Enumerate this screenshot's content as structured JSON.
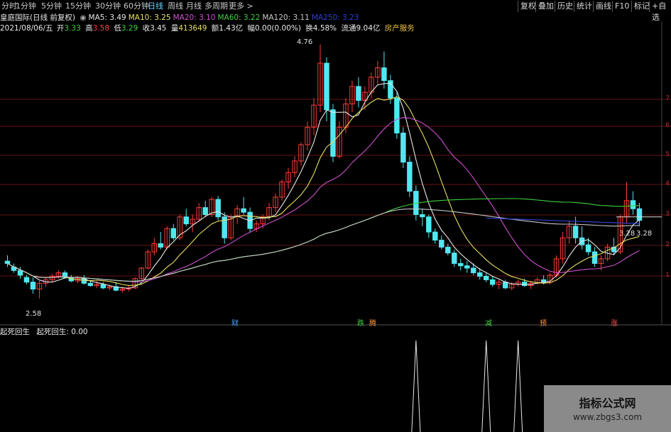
{
  "toolbar": {
    "periods": [
      "分时",
      "1分钟",
      "5分钟",
      "15分钟",
      "30分钟",
      "60分钟",
      "日线",
      "周线",
      "月线",
      "多周期",
      "更多 >"
    ],
    "active_period": "日线",
    "right_buttons": [
      "复权",
      "叠加",
      "历史",
      "统计",
      "画线",
      "F10",
      "标记",
      "+自选"
    ]
  },
  "header": {
    "title": "皇庭国际(日线 前复权)",
    "ma": [
      {
        "label": "MA5: 3.49",
        "color": "#e8e8e8"
      },
      {
        "label": "MA10: 3.25",
        "color": "#e8e060"
      },
      {
        "label": "MA20: 3.10",
        "color": "#d050d0"
      },
      {
        "label": "MA60: 3.22",
        "color": "#40d040"
      },
      {
        "label": "MA120: 3.11",
        "color": "#c8c8c8"
      },
      {
        "label": "MA250: 3.23",
        "color": "#3040d0"
      }
    ],
    "date": "2021/08/06/五",
    "open_label": "开",
    "open": "3.33",
    "high_label": "高",
    "high": "3.58",
    "low_label": "低",
    "low": "3.29",
    "close_label": "收",
    "close": "3.45",
    "vol_label": "量",
    "vol": "413649",
    "amount_label": "额",
    "amount": "1.43亿",
    "change_label": "幅",
    "change": "0.00(0.00%)",
    "turnover_label": "换",
    "turnover": "4.58%",
    "float_label": "流通",
    "float": "9.04亿",
    "sector": "房产服务"
  },
  "price_labels": {
    "high": "4.76",
    "low": "2.58",
    "last": "3.28",
    "last_left": "3.28"
  },
  "y_ticks": [
    "1",
    "2",
    "3",
    "4",
    "5",
    "6",
    "7"
  ],
  "events": [
    {
      "label": "财",
      "color": "#4aa0ff"
    },
    {
      "label": "跌",
      "color": "#40d040"
    },
    {
      "label": "腾",
      "color": "#ff9030"
    },
    {
      "label": "减",
      "color": "#40d040"
    },
    {
      "label": "预",
      "color": "#ff9030"
    },
    {
      "label": "涨",
      "color": "#ff5050"
    }
  ],
  "indicator": {
    "name": "起死回生",
    "value": "起死回生: 0.00"
  },
  "watermark": {
    "title": "指标公式网",
    "url": "www.zbgs3.com"
  },
  "colors": {
    "up": "#ff3a3a",
    "down": "#50e8f0",
    "ma5": "#e8e8e8",
    "ma10": "#e8e060",
    "ma20": "#d050d0",
    "ma60": "#40d040",
    "ma120": "#c8c8c8",
    "ma250": "#3040d0",
    "grid": "#8b1a1a"
  },
  "chart_data": {
    "type": "candlestick",
    "ylim": [
      2.45,
      4.85
    ],
    "candles": [
      [
        2.9,
        2.95,
        2.85,
        2.88
      ],
      [
        2.85,
        2.88,
        2.8,
        2.82
      ],
      [
        2.82,
        2.85,
        2.75,
        2.78
      ],
      [
        2.76,
        2.78,
        2.7,
        2.72
      ],
      [
        2.72,
        2.76,
        2.62,
        2.66
      ],
      [
        2.66,
        2.73,
        2.58,
        2.71
      ],
      [
        2.71,
        2.76,
        2.68,
        2.74
      ],
      [
        2.74,
        2.79,
        2.72,
        2.77
      ],
      [
        2.77,
        2.82,
        2.75,
        2.8
      ],
      [
        2.8,
        2.82,
        2.75,
        2.76
      ],
      [
        2.76,
        2.78,
        2.72,
        2.73
      ],
      [
        2.73,
        2.77,
        2.71,
        2.75
      ],
      [
        2.75,
        2.78,
        2.7,
        2.71
      ],
      [
        2.71,
        2.74,
        2.68,
        2.69
      ],
      [
        2.69,
        2.73,
        2.67,
        2.7
      ],
      [
        2.7,
        2.72,
        2.66,
        2.67
      ],
      [
        2.67,
        2.7,
        2.65,
        2.68
      ],
      [
        2.68,
        2.72,
        2.64,
        2.65
      ],
      [
        2.65,
        2.68,
        2.63,
        2.66
      ],
      [
        2.66,
        2.69,
        2.64,
        2.67
      ],
      [
        2.67,
        2.76,
        2.66,
        2.75
      ],
      [
        2.75,
        2.85,
        2.74,
        2.84
      ],
      [
        2.84,
        3.0,
        2.83,
        2.98
      ],
      [
        2.98,
        3.1,
        2.95,
        3.05
      ],
      [
        3.05,
        3.15,
        3.0,
        3.02
      ],
      [
        3.02,
        3.2,
        3.0,
        3.18
      ],
      [
        3.18,
        3.22,
        3.08,
        3.1
      ],
      [
        3.1,
        3.3,
        3.08,
        3.28
      ],
      [
        3.28,
        3.35,
        3.2,
        3.22
      ],
      [
        3.22,
        3.3,
        3.15,
        3.26
      ],
      [
        3.26,
        3.4,
        3.24,
        3.36
      ],
      [
        3.36,
        3.42,
        3.28,
        3.3
      ],
      [
        3.3,
        3.45,
        3.28,
        3.43
      ],
      [
        3.43,
        3.46,
        3.25,
        3.28
      ],
      [
        3.28,
        3.32,
        3.05,
        3.1
      ],
      [
        3.1,
        3.3,
        3.08,
        3.28
      ],
      [
        3.28,
        3.38,
        3.22,
        3.35
      ],
      [
        3.35,
        3.45,
        3.3,
        3.32
      ],
      [
        3.32,
        3.36,
        3.15,
        3.18
      ],
      [
        3.18,
        3.25,
        3.15,
        3.22
      ],
      [
        3.22,
        3.3,
        3.18,
        3.28
      ],
      [
        3.28,
        3.4,
        3.25,
        3.36
      ],
      [
        3.36,
        3.48,
        3.32,
        3.45
      ],
      [
        3.45,
        3.6,
        3.42,
        3.58
      ],
      [
        3.58,
        3.7,
        3.52,
        3.66
      ],
      [
        3.66,
        3.8,
        3.62,
        3.76
      ],
      [
        3.76,
        3.92,
        3.72,
        3.9
      ],
      [
        3.9,
        4.1,
        3.85,
        4.05
      ],
      [
        4.05,
        4.3,
        3.98,
        4.24
      ],
      [
        4.24,
        4.76,
        4.18,
        4.6
      ],
      [
        4.6,
        4.65,
        4.1,
        4.2
      ],
      [
        4.2,
        4.25,
        3.75,
        3.8
      ],
      [
        3.8,
        4.1,
        3.78,
        4.05
      ],
      [
        4.05,
        4.3,
        4.0,
        4.25
      ],
      [
        4.25,
        4.45,
        4.18,
        4.4
      ],
      [
        4.4,
        4.48,
        4.22,
        4.28
      ],
      [
        4.28,
        4.4,
        4.2,
        4.35
      ],
      [
        4.35,
        4.52,
        4.3,
        4.48
      ],
      [
        4.48,
        4.62,
        4.42,
        4.56
      ],
      [
        4.56,
        4.7,
        4.38,
        4.45
      ],
      [
        4.45,
        4.5,
        4.25,
        4.3
      ],
      [
        4.3,
        4.35,
        3.95,
        4.0
      ],
      [
        4.0,
        4.05,
        3.7,
        3.75
      ],
      [
        3.75,
        3.8,
        3.45,
        3.5
      ],
      [
        3.5,
        3.55,
        3.25,
        3.3
      ],
      [
        3.3,
        3.35,
        3.2,
        3.28
      ],
      [
        3.28,
        3.3,
        3.1,
        3.15
      ],
      [
        3.15,
        3.18,
        3.05,
        3.08
      ],
      [
        3.08,
        3.12,
        3.0,
        3.02
      ],
      [
        3.02,
        3.05,
        2.95,
        2.97
      ],
      [
        2.97,
        3.0,
        2.85,
        2.88
      ],
      [
        2.88,
        2.92,
        2.82,
        2.86
      ],
      [
        2.86,
        2.9,
        2.8,
        2.84
      ],
      [
        2.84,
        2.88,
        2.78,
        2.8
      ],
      [
        2.8,
        2.84,
        2.74,
        2.77
      ],
      [
        2.77,
        2.8,
        2.72,
        2.74
      ],
      [
        2.74,
        2.77,
        2.68,
        2.7
      ],
      [
        2.7,
        2.74,
        2.66,
        2.72
      ],
      [
        2.72,
        2.74,
        2.66,
        2.67
      ],
      [
        2.67,
        2.72,
        2.65,
        2.7
      ],
      [
        2.7,
        2.74,
        2.68,
        2.72
      ],
      [
        2.72,
        2.75,
        2.68,
        2.69
      ],
      [
        2.69,
        2.73,
        2.66,
        2.71
      ],
      [
        2.71,
        2.76,
        2.7,
        2.74
      ],
      [
        2.74,
        2.78,
        2.7,
        2.72
      ],
      [
        2.72,
        2.8,
        2.7,
        2.78
      ],
      [
        2.78,
        2.95,
        2.76,
        2.92
      ],
      [
        2.92,
        3.15,
        2.88,
        3.1
      ],
      [
        3.1,
        3.25,
        3.05,
        3.2
      ],
      [
        3.2,
        3.28,
        3.05,
        3.1
      ],
      [
        3.1,
        3.2,
        3.0,
        3.04
      ],
      [
        3.04,
        3.1,
        2.95,
        2.98
      ],
      [
        2.98,
        3.02,
        2.85,
        2.88
      ],
      [
        2.88,
        2.95,
        2.82,
        2.92
      ],
      [
        2.92,
        3.05,
        2.9,
        3.02
      ],
      [
        3.02,
        3.1,
        2.95,
        2.98
      ],
      [
        2.98,
        3.3,
        2.96,
        3.28
      ],
      [
        3.28,
        3.58,
        3.22,
        3.42
      ],
      [
        3.42,
        3.5,
        3.3,
        3.35
      ],
      [
        3.35,
        3.4,
        3.2,
        3.25
      ]
    ],
    "indicator_spikes": [
      {
        "index": 64,
        "value": 1
      },
      {
        "index": 75,
        "value": 1
      },
      {
        "index": 80,
        "value": 1
      }
    ]
  }
}
